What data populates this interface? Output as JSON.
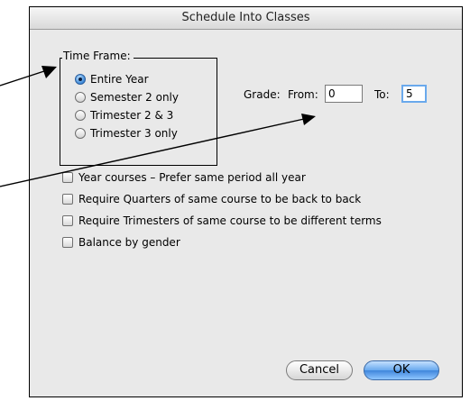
{
  "dialog": {
    "title": "Schedule Into Classes"
  },
  "time_frame": {
    "legend": "Time Frame:",
    "options": [
      {
        "label": "Entire Year",
        "selected": true
      },
      {
        "label": "Semester 2 only",
        "selected": false
      },
      {
        "label": "Trimester 2 & 3",
        "selected": false
      },
      {
        "label": "Trimester 3 only",
        "selected": false
      }
    ]
  },
  "grade": {
    "label": "Grade:",
    "from_label": "From:",
    "from_value": "0",
    "to_label": "To:",
    "to_value": "5"
  },
  "options": [
    {
      "label": "Year courses – Prefer same period all year",
      "checked": false
    },
    {
      "label": "Require Quarters of same course to be back to back",
      "checked": false
    },
    {
      "label": "Require Trimesters of same course to be different terms",
      "checked": false
    },
    {
      "label": "Balance by gender",
      "checked": false
    }
  ],
  "buttons": {
    "cancel": "Cancel",
    "ok": "OK"
  }
}
